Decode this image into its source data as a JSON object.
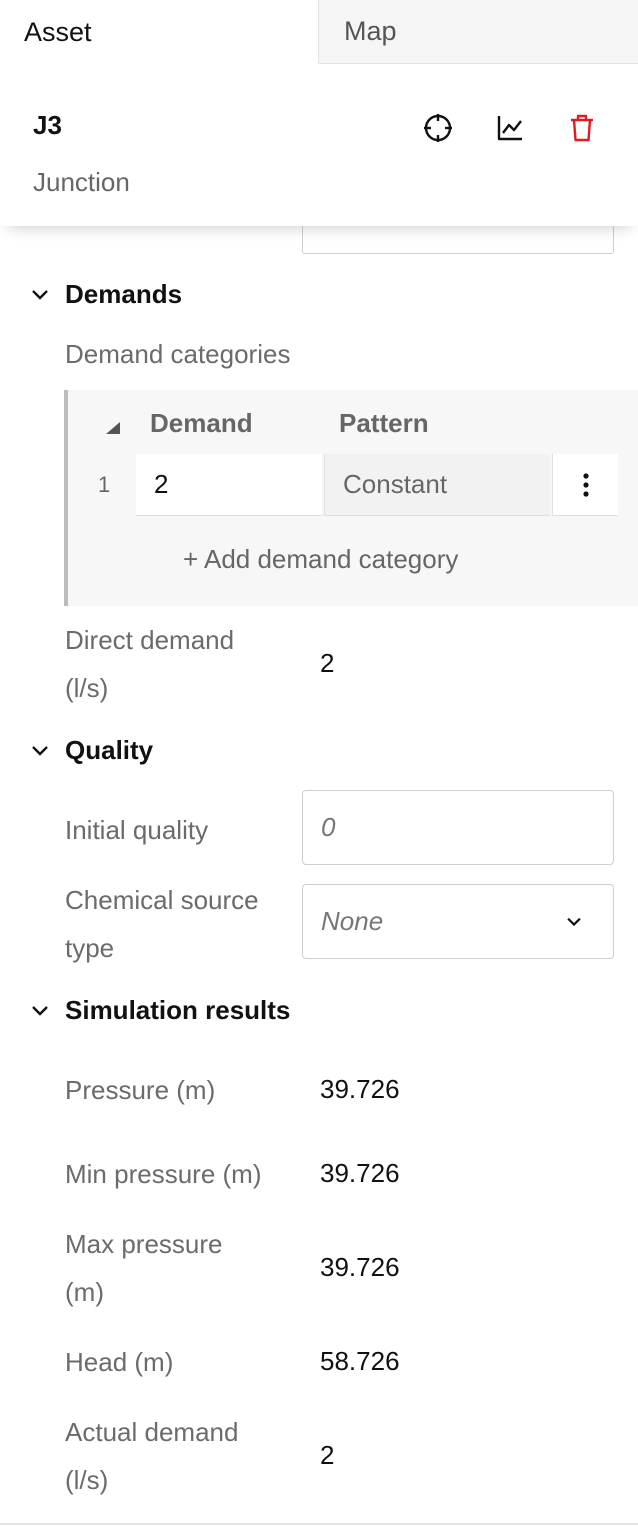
{
  "tabs": {
    "asset": "Asset",
    "map": "Map"
  },
  "header": {
    "asset_id": "J3",
    "asset_type": "Junction",
    "icons": [
      "crosshair-icon",
      "chart-icon",
      "trash-icon"
    ],
    "delete_color": "#e01b24"
  },
  "demands": {
    "title": "Demands",
    "categories_label": "Demand categories",
    "table": {
      "col_demand": "Demand",
      "col_pattern": "Pattern",
      "rows": [
        {
          "index": "1",
          "demand": "2",
          "pattern": "Constant"
        }
      ],
      "add_label": "+ Add demand category"
    },
    "direct_label_1": "Direct demand",
    "direct_label_2": "(l/s)",
    "direct_value": "2"
  },
  "quality": {
    "title": "Quality",
    "initial_label": "Initial quality",
    "initial_placeholder": "0",
    "source_label_1": "Chemical source",
    "source_label_2": "type",
    "source_value": "None"
  },
  "results": {
    "title": "Simulation results",
    "pressure_label": "Pressure (m)",
    "pressure_value": "39.726",
    "min_label": "Min pressure (m)",
    "min_value": "39.726",
    "max_label_1": "Max pressure",
    "max_label_2": "(m)",
    "max_value": "39.726",
    "head_label": "Head (m)",
    "head_value": "58.726",
    "actual_label_1": "Actual demand",
    "actual_label_2": "(l/s)",
    "actual_value": "2"
  }
}
